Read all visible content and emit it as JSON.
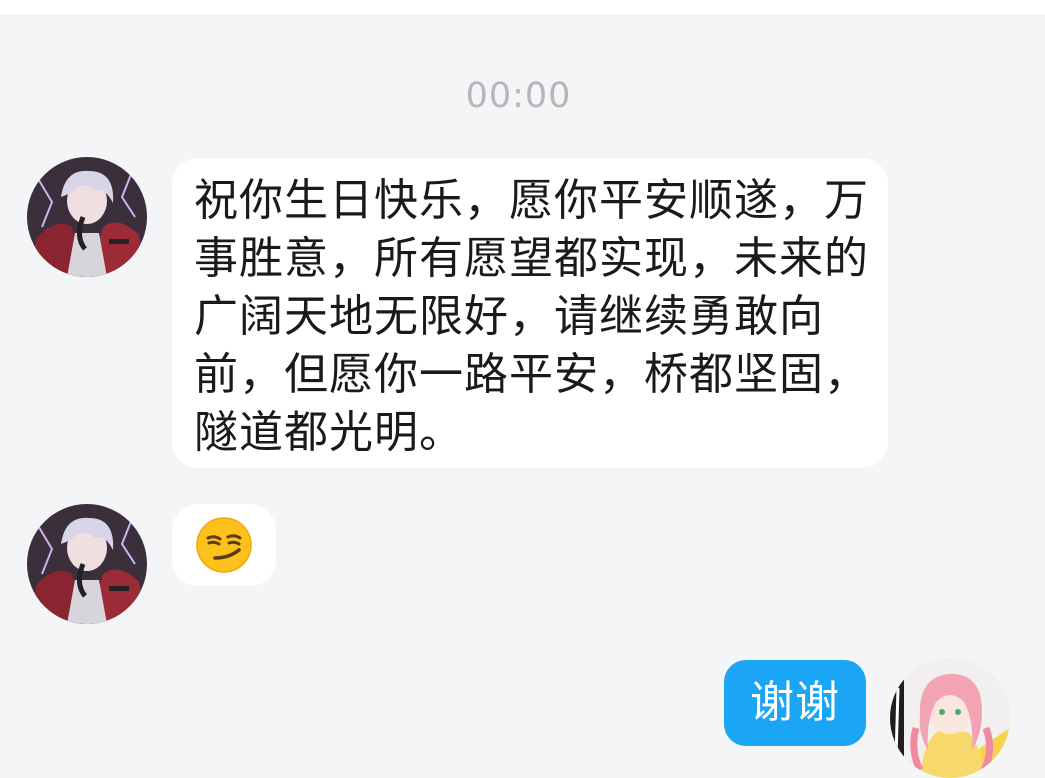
{
  "chat": {
    "timestamp": "00:00",
    "messages": [
      {
        "sender": "other",
        "text": "祝你生日快乐，愿你平安顺遂，万事胜意，所有愿望都实现，未来的广阔天地无限好，请继续勇敢向前，但愿你一路平安，桥都坚固，隧道都光明。"
      },
      {
        "sender": "other",
        "emoji": "smirk-face-emoji"
      },
      {
        "sender": "self",
        "text": "谢谢"
      }
    ]
  },
  "colors": {
    "background": "#f4f5f7",
    "incoming_bubble": "#ffffff",
    "outgoing_bubble": "#1aa6f5",
    "timestamp_text": "#b4b6ba"
  },
  "icons": {
    "other_avatar": "anime-boy-avatar",
    "self_avatar": "anime-girl-avatar"
  }
}
